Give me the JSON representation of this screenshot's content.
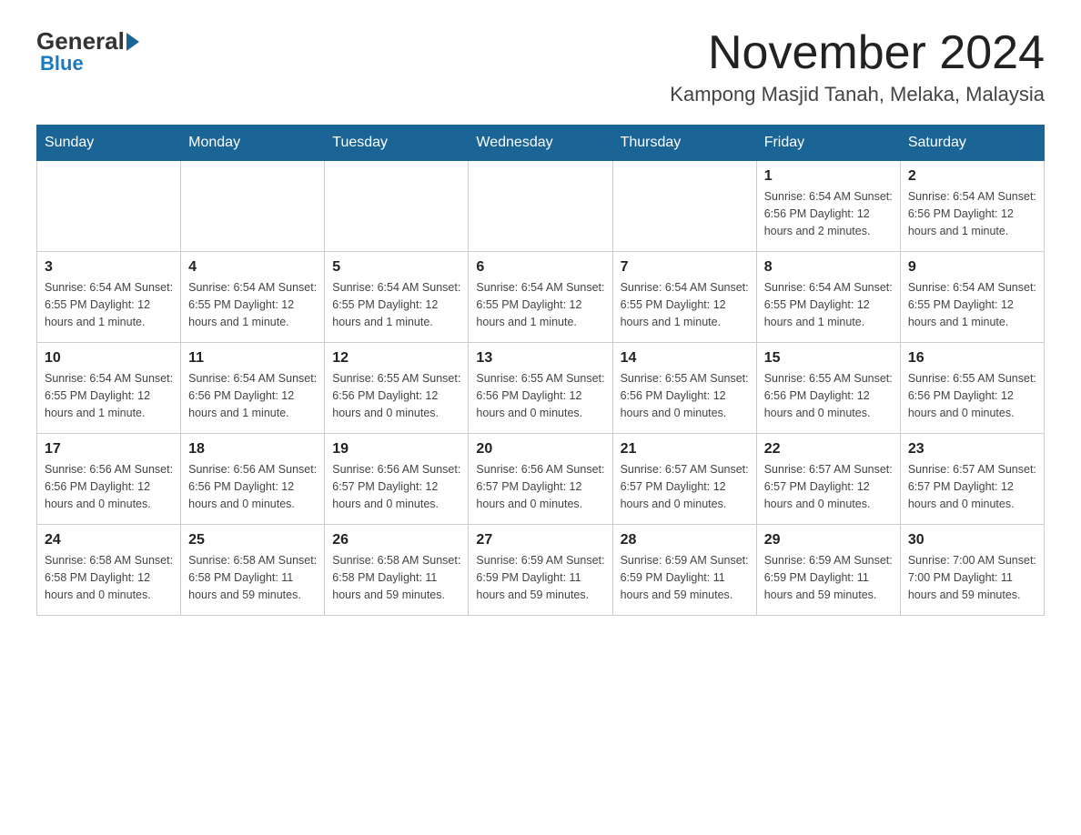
{
  "logo": {
    "general": "General",
    "blue": "Blue"
  },
  "title": "November 2024",
  "location": "Kampong Masjid Tanah, Melaka, Malaysia",
  "days_header": [
    "Sunday",
    "Monday",
    "Tuesday",
    "Wednesday",
    "Thursday",
    "Friday",
    "Saturday"
  ],
  "weeks": [
    [
      {
        "day": "",
        "info": ""
      },
      {
        "day": "",
        "info": ""
      },
      {
        "day": "",
        "info": ""
      },
      {
        "day": "",
        "info": ""
      },
      {
        "day": "",
        "info": ""
      },
      {
        "day": "1",
        "info": "Sunrise: 6:54 AM\nSunset: 6:56 PM\nDaylight: 12 hours and 2 minutes."
      },
      {
        "day": "2",
        "info": "Sunrise: 6:54 AM\nSunset: 6:56 PM\nDaylight: 12 hours and 1 minute."
      }
    ],
    [
      {
        "day": "3",
        "info": "Sunrise: 6:54 AM\nSunset: 6:55 PM\nDaylight: 12 hours and 1 minute."
      },
      {
        "day": "4",
        "info": "Sunrise: 6:54 AM\nSunset: 6:55 PM\nDaylight: 12 hours and 1 minute."
      },
      {
        "day": "5",
        "info": "Sunrise: 6:54 AM\nSunset: 6:55 PM\nDaylight: 12 hours and 1 minute."
      },
      {
        "day": "6",
        "info": "Sunrise: 6:54 AM\nSunset: 6:55 PM\nDaylight: 12 hours and 1 minute."
      },
      {
        "day": "7",
        "info": "Sunrise: 6:54 AM\nSunset: 6:55 PM\nDaylight: 12 hours and 1 minute."
      },
      {
        "day": "8",
        "info": "Sunrise: 6:54 AM\nSunset: 6:55 PM\nDaylight: 12 hours and 1 minute."
      },
      {
        "day": "9",
        "info": "Sunrise: 6:54 AM\nSunset: 6:55 PM\nDaylight: 12 hours and 1 minute."
      }
    ],
    [
      {
        "day": "10",
        "info": "Sunrise: 6:54 AM\nSunset: 6:55 PM\nDaylight: 12 hours and 1 minute."
      },
      {
        "day": "11",
        "info": "Sunrise: 6:54 AM\nSunset: 6:56 PM\nDaylight: 12 hours and 1 minute."
      },
      {
        "day": "12",
        "info": "Sunrise: 6:55 AM\nSunset: 6:56 PM\nDaylight: 12 hours and 0 minutes."
      },
      {
        "day": "13",
        "info": "Sunrise: 6:55 AM\nSunset: 6:56 PM\nDaylight: 12 hours and 0 minutes."
      },
      {
        "day": "14",
        "info": "Sunrise: 6:55 AM\nSunset: 6:56 PM\nDaylight: 12 hours and 0 minutes."
      },
      {
        "day": "15",
        "info": "Sunrise: 6:55 AM\nSunset: 6:56 PM\nDaylight: 12 hours and 0 minutes."
      },
      {
        "day": "16",
        "info": "Sunrise: 6:55 AM\nSunset: 6:56 PM\nDaylight: 12 hours and 0 minutes."
      }
    ],
    [
      {
        "day": "17",
        "info": "Sunrise: 6:56 AM\nSunset: 6:56 PM\nDaylight: 12 hours and 0 minutes."
      },
      {
        "day": "18",
        "info": "Sunrise: 6:56 AM\nSunset: 6:56 PM\nDaylight: 12 hours and 0 minutes."
      },
      {
        "day": "19",
        "info": "Sunrise: 6:56 AM\nSunset: 6:57 PM\nDaylight: 12 hours and 0 minutes."
      },
      {
        "day": "20",
        "info": "Sunrise: 6:56 AM\nSunset: 6:57 PM\nDaylight: 12 hours and 0 minutes."
      },
      {
        "day": "21",
        "info": "Sunrise: 6:57 AM\nSunset: 6:57 PM\nDaylight: 12 hours and 0 minutes."
      },
      {
        "day": "22",
        "info": "Sunrise: 6:57 AM\nSunset: 6:57 PM\nDaylight: 12 hours and 0 minutes."
      },
      {
        "day": "23",
        "info": "Sunrise: 6:57 AM\nSunset: 6:57 PM\nDaylight: 12 hours and 0 minutes."
      }
    ],
    [
      {
        "day": "24",
        "info": "Sunrise: 6:58 AM\nSunset: 6:58 PM\nDaylight: 12 hours and 0 minutes."
      },
      {
        "day": "25",
        "info": "Sunrise: 6:58 AM\nSunset: 6:58 PM\nDaylight: 11 hours and 59 minutes."
      },
      {
        "day": "26",
        "info": "Sunrise: 6:58 AM\nSunset: 6:58 PM\nDaylight: 11 hours and 59 minutes."
      },
      {
        "day": "27",
        "info": "Sunrise: 6:59 AM\nSunset: 6:59 PM\nDaylight: 11 hours and 59 minutes."
      },
      {
        "day": "28",
        "info": "Sunrise: 6:59 AM\nSunset: 6:59 PM\nDaylight: 11 hours and 59 minutes."
      },
      {
        "day": "29",
        "info": "Sunrise: 6:59 AM\nSunset: 6:59 PM\nDaylight: 11 hours and 59 minutes."
      },
      {
        "day": "30",
        "info": "Sunrise: 7:00 AM\nSunset: 7:00 PM\nDaylight: 11 hours and 59 minutes."
      }
    ]
  ]
}
